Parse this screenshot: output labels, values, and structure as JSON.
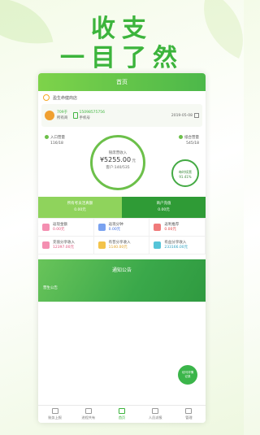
{
  "hero": {
    "line1": "收支",
    "line2": "一目了然"
  },
  "app": {
    "header_title": "首页",
    "shop_name": "盈生命健商店",
    "user": {
      "id": "709于",
      "role": "所有商",
      "phone": "15098575756",
      "phone_label": "手机号",
      "date": "2019-05-08"
    },
    "left_items": [
      {
        "label": "入口营量",
        "value": "116/18"
      }
    ],
    "right_items": [
      {
        "label": "纸合营量",
        "value": "545/18"
      }
    ],
    "center": {
      "label": "银席营收入",
      "amount": "¥5255.00",
      "unit": "元",
      "sub": "客户:140/535"
    },
    "rate": {
      "label": "每时续营",
      "value": "91.41%"
    },
    "stats": [
      {
        "label": "所有考员活真额",
        "value": "0.00元"
      },
      {
        "label": "商户充值",
        "value": "0.00元"
      }
    ],
    "grid": [
      {
        "label": "返现金额",
        "value": "0.00元",
        "color": "pink"
      },
      {
        "label": "返现分钟",
        "value": "0.00元",
        "color": "blue"
      },
      {
        "label": "返利推荐",
        "value": "0.00元",
        "color": "red"
      },
      {
        "label": "充值分享收入",
        "value": "12397.00元",
        "color": "pink"
      },
      {
        "label": "有普分享收入",
        "value": "1140.00元",
        "color": "yellow"
      },
      {
        "label": "有益分享收入",
        "value": "233166.00元",
        "color": "cyan"
      }
    ],
    "notice": {
      "title": "通知公告",
      "sub": "营生公告"
    },
    "fab": {
      "line1": "访问详情",
      "line2": "记录"
    },
    "tabs": [
      {
        "label": "账务上报",
        "icon": "ledger-icon"
      },
      {
        "label": "进程共有",
        "icon": "chart-icon"
      },
      {
        "label": "首页",
        "icon": "home-icon"
      },
      {
        "label": "人员派报",
        "icon": "user-icon"
      },
      {
        "label": "管理",
        "icon": "settings-icon"
      }
    ]
  }
}
